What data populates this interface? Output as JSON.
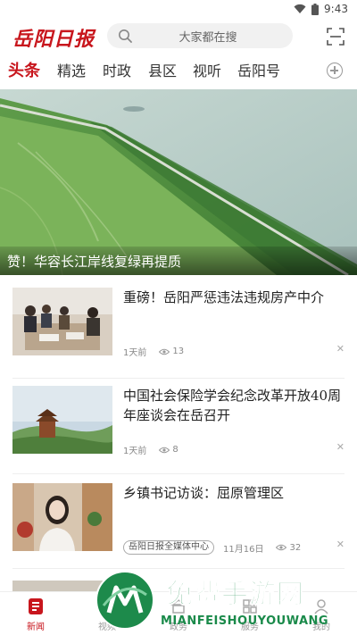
{
  "status_bar": {
    "time": "9:43"
  },
  "header": {
    "logo_text": "岳阳日报",
    "search_placeholder": "大家都在搜",
    "accent_color": "#c8161d"
  },
  "tabs": [
    {
      "label": "头条",
      "active": true
    },
    {
      "label": "精选"
    },
    {
      "label": "时政"
    },
    {
      "label": "县区"
    },
    {
      "label": "视听"
    },
    {
      "label": "岳阳号"
    }
  ],
  "hero": {
    "caption": "赞！华容长江岸线复绿再提质"
  },
  "news": [
    {
      "title": "重磅！岳阳严惩违法违规房产中介",
      "time": "1天前",
      "views": "13"
    },
    {
      "title": "中国社会保险学会纪念改革开放40周年座谈会在岳召开",
      "time": "1天前",
      "views": "8"
    },
    {
      "title": "乡镇书记访谈：屈原管理区",
      "source": "岳阳日报全媒体中心",
      "time": "11月16日",
      "views": "32"
    }
  ],
  "bottom_nav": [
    {
      "label": "新闻",
      "icon": "news-icon",
      "active": true
    },
    {
      "label": "视频",
      "icon": "video-icon"
    },
    {
      "label": "政务",
      "icon": "gov-icon"
    },
    {
      "label": "服务",
      "icon": "service-icon"
    },
    {
      "label": "我的",
      "icon": "user-icon"
    }
  ],
  "watermark": {
    "main": "免费手游网",
    "sub": "MIANFEISHOUYOUWANG"
  }
}
